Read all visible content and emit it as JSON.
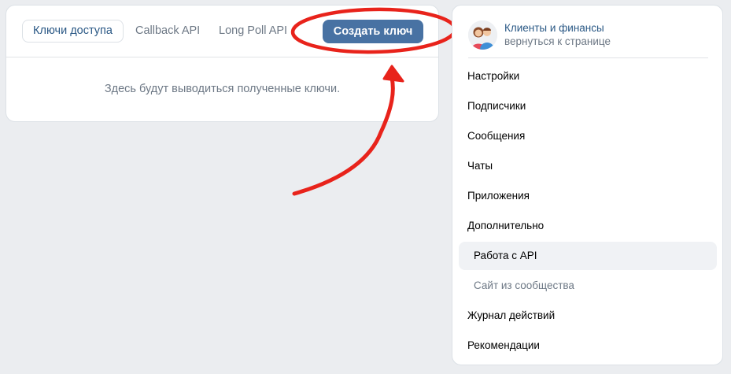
{
  "tabs": {
    "access_keys": "Ключи доступа",
    "callback_api": "Callback API",
    "long_poll_api": "Long Poll API"
  },
  "create_key_label": "Создать ключ",
  "empty_message": "Здесь будут выводиться полученные ключи.",
  "sidebar": {
    "group_name": "Клиенты и финансы",
    "back_link": "вернуться к странице",
    "items": [
      {
        "label": "Настройки"
      },
      {
        "label": "Подписчики"
      },
      {
        "label": "Сообщения"
      },
      {
        "label": "Чаты"
      },
      {
        "label": "Приложения"
      },
      {
        "label": "Дополнительно"
      },
      {
        "label": "Работа с API"
      },
      {
        "label": "Сайт из сообщества"
      },
      {
        "label": "Журнал действий"
      },
      {
        "label": "Рекомендации"
      }
    ]
  },
  "colors": {
    "accent": "#4872a3",
    "link": "#2a5885",
    "annotation": "#e8231b",
    "background": "#ebedf0"
  },
  "icons": {
    "annotation_arrow": "red-arrow-icon",
    "annotation_ellipse": "red-ellipse-highlight"
  }
}
